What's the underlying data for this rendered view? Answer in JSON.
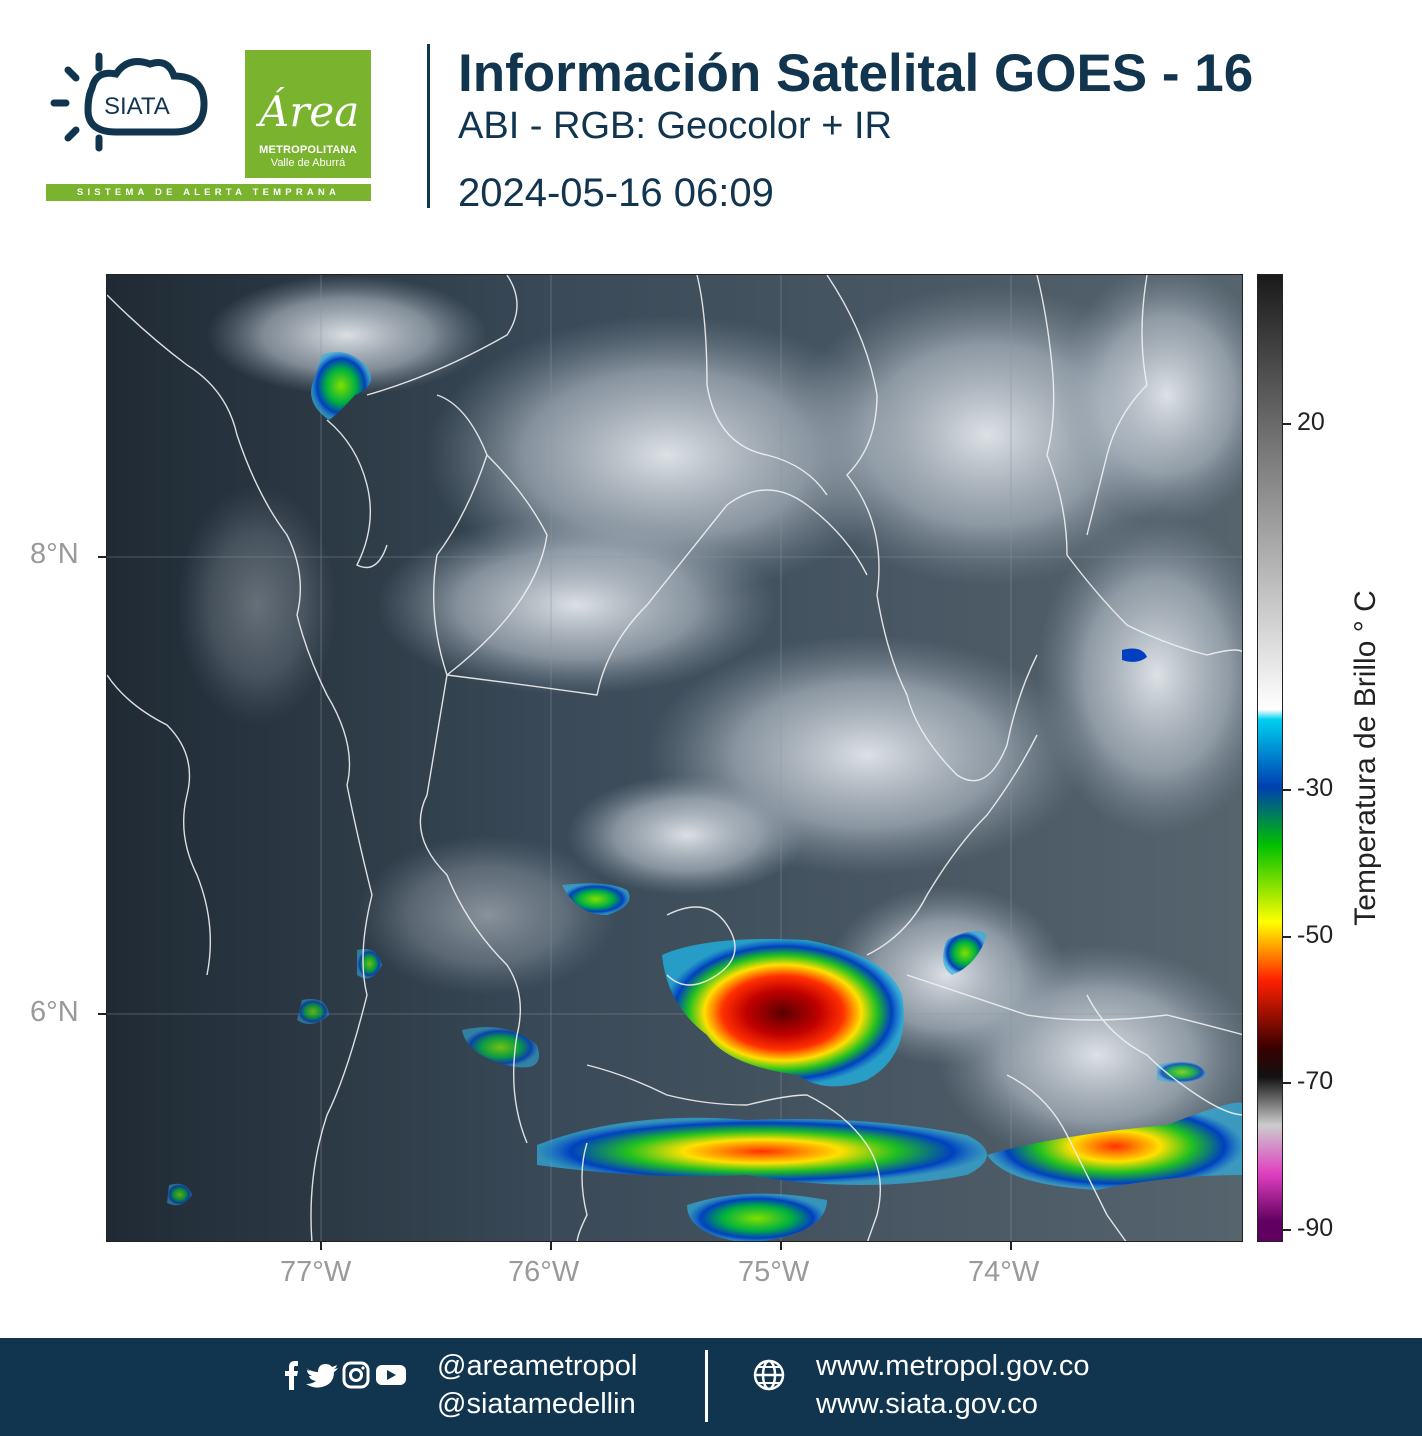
{
  "header": {
    "siata_logo_text": "SIATA",
    "siata_tagline": "SISTEMA DE ALERTA TEMPRANA",
    "area_logo_script": "Área",
    "area_logo_line1": "METROPOLITANA",
    "area_logo_line2": "Valle de Aburrá",
    "title": "Información Satelital GOES - 16",
    "subtitle": "ABI - RGB: Geocolor + IR",
    "timestamp": "2024-05-16 06:09"
  },
  "map": {
    "lat_labels": [
      "8°N",
      "6°N"
    ],
    "lon_labels": [
      "77°W",
      "76°W",
      "75°W",
      "74°W"
    ],
    "colors": {
      "base_dark": "#2b3a48",
      "cloud": "#d8dde2",
      "border_lines": "#ffffff"
    }
  },
  "colorbar": {
    "title": "Temperatura de Brillo  ° C",
    "ticks": [
      "20",
      "-30",
      "-50",
      "-70",
      "-90"
    ],
    "colors": [
      "#1a1a1a",
      "#777777",
      "#ffffff",
      "#00d0f0",
      "#003fb0",
      "#00c000",
      "#ffff00",
      "#ff2000",
      "#3a0000",
      "#111111",
      "#cccccc",
      "#e040c0",
      "#600060"
    ]
  },
  "footer": {
    "social_icons": [
      "facebook-icon",
      "twitter-icon",
      "instagram-icon",
      "youtube-icon"
    ],
    "handle_1": "@areametropol",
    "handle_2": "@siatamedellin",
    "url_1": "www.metropol.gov.co",
    "url_2": "www.siata.gov.co",
    "background": "#12354f"
  }
}
